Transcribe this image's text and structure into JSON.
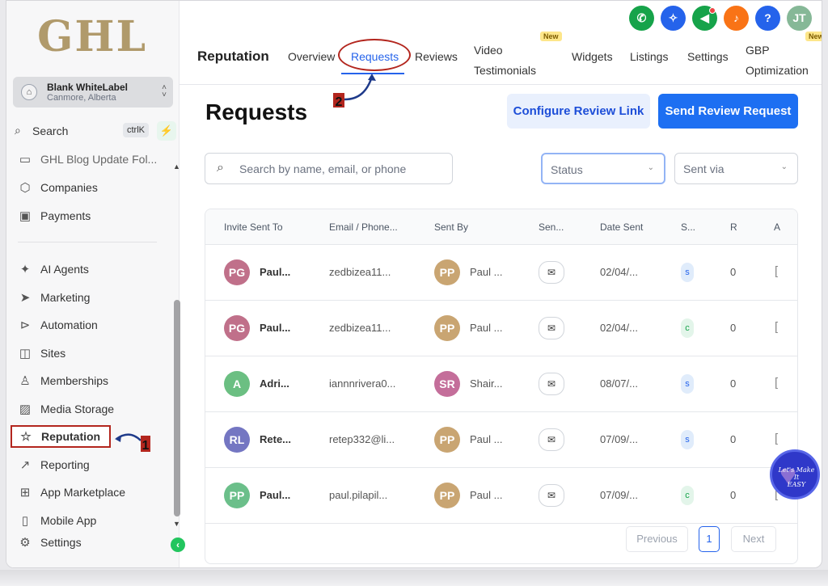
{
  "logo": "GHL",
  "account": {
    "name": "Blank WhiteLabel",
    "location": "Canmore, Alberta"
  },
  "sidebar_search": {
    "label": "Search",
    "shortcut": "ctrlK"
  },
  "nav": {
    "cut_item": "GHL Blog Update Fol...",
    "items": [
      "Companies",
      "Payments",
      "AI Agents",
      "Marketing",
      "Automation",
      "Sites",
      "Memberships",
      "Media Storage",
      "Reputation",
      "Reporting",
      "App Marketplace",
      "Mobile App",
      "Settings"
    ],
    "active": "Reputation"
  },
  "top_icons": [
    {
      "name": "phone-icon",
      "color": "#16a34a",
      "glyph": "✆"
    },
    {
      "name": "sparkle-icon",
      "color": "#2563eb",
      "glyph": "✧"
    },
    {
      "name": "megaphone-icon",
      "color": "#16a34a",
      "glyph": "📢"
    },
    {
      "name": "bell-icon",
      "color": "#f97316",
      "glyph": "🔔"
    },
    {
      "name": "help-icon",
      "color": "#2563eb",
      "glyph": "?"
    },
    {
      "name": "user-avatar",
      "color": "#86b897",
      "glyph": "JT"
    }
  ],
  "tabs": {
    "title": "Reputation",
    "overview": "Overview",
    "requests": "Requests",
    "reviews": "Reviews",
    "video_line1": "Video",
    "video_line2": "Testimonials",
    "widgets": "Widgets",
    "listings": "Listings",
    "settings": "Settings",
    "gbp_line1": "GBP",
    "gbp_line2": "Optimization",
    "new_badge": "New"
  },
  "annotations": {
    "step1": "1",
    "step2": "2"
  },
  "page_title": "Requests",
  "buttons": {
    "configure": "Configure Review Link",
    "send": "Send Review Request"
  },
  "search": {
    "placeholder": "Search by name, email, or phone"
  },
  "filters": {
    "status": "Status",
    "sent_via": "Sent via"
  },
  "table": {
    "headers": [
      "Invite Sent To",
      "Email / Phone...",
      "Sent By",
      "Sen...",
      "Date Sent",
      "S...",
      "R",
      "A"
    ],
    "rows": [
      {
        "initials": "PG",
        "avatar_color": "#c0708a",
        "name": "Paul...",
        "email": "zedbizea11...",
        "by_initials": "PP",
        "by_color": "#c9a572",
        "by": "Paul ...",
        "date": "02/04/...",
        "status": "s",
        "status_color": "#e0ecfb",
        "status_text_color": "#2563eb",
        "reviews": "0"
      },
      {
        "initials": "PG",
        "avatar_color": "#c0708a",
        "name": "Paul...",
        "email": "zedbizea11...",
        "by_initials": "PP",
        "by_color": "#c9a572",
        "by": "Paul ...",
        "date": "02/04/...",
        "status": "c",
        "status_color": "#e3f5ea",
        "status_text_color": "#16a34a",
        "reviews": "0"
      },
      {
        "initials": "A",
        "avatar_color": "#6bbf82",
        "name": "Adri...",
        "email": "iannnrivera0...",
        "by_initials": "SR",
        "by_color": "#c46e9a",
        "by": "Shair...",
        "date": "08/07/...",
        "status": "s",
        "status_color": "#e0ecfb",
        "status_text_color": "#2563eb",
        "reviews": "0"
      },
      {
        "initials": "RL",
        "avatar_color": "#7476c2",
        "name": "Rete...",
        "email": "retep332@li...",
        "by_initials": "PP",
        "by_color": "#c9a572",
        "by": "Paul ...",
        "date": "07/09/...",
        "status": "s",
        "status_color": "#e0ecfb",
        "status_text_color": "#2563eb",
        "reviews": "0"
      },
      {
        "initials": "PP",
        "avatar_color": "#6bbf8a",
        "name": "Paul...",
        "email": "paul.pilapil...",
        "by_initials": "PP",
        "by_color": "#c9a572",
        "by": "Paul ...",
        "date": "07/09/...",
        "status": "c",
        "status_color": "#e3f5ea",
        "status_text_color": "#16a34a",
        "reviews": "0"
      }
    ]
  },
  "pagination": {
    "previous": "Previous",
    "page": "1",
    "next": "Next"
  },
  "badge": {
    "line1": "Let's Make",
    "line2": "It",
    "line3": "EASY"
  }
}
